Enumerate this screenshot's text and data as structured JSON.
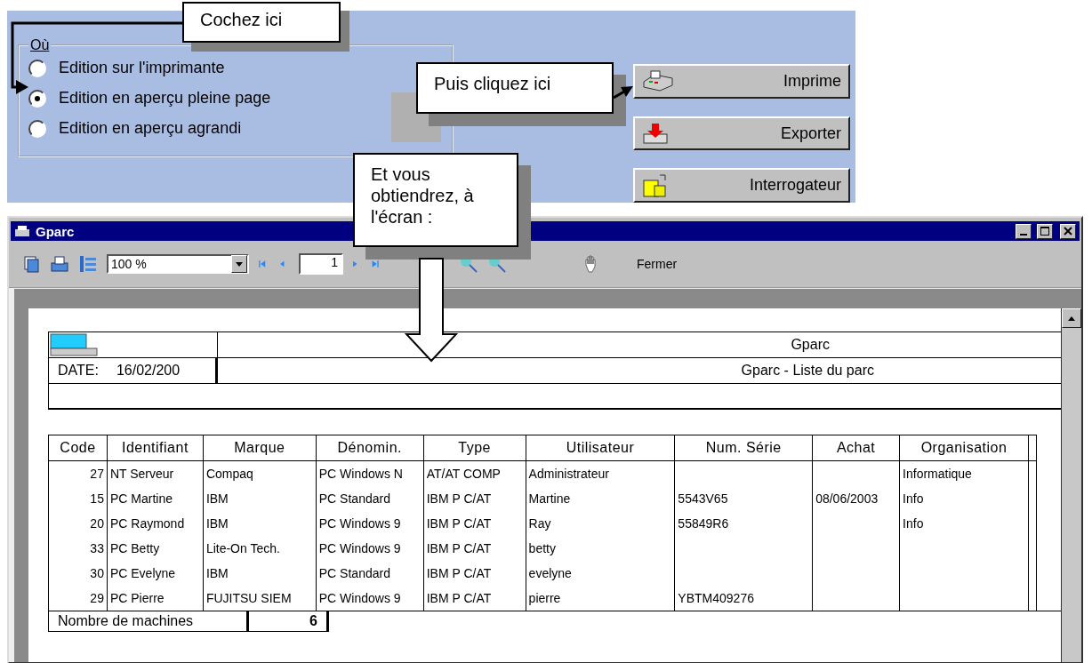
{
  "dialog": {
    "group_label": "Où",
    "options": [
      {
        "label": "Edition sur l'imprimante",
        "selected": false
      },
      {
        "label": "Edition en aperçu pleine page",
        "selected": true
      },
      {
        "label": "Edition en aperçu agrandi",
        "selected": false
      }
    ],
    "buttons": [
      {
        "label": "Imprime",
        "kind": "print"
      },
      {
        "label": "Exporter",
        "kind": "export"
      },
      {
        "label": "Interrogateur",
        "kind": "query"
      }
    ]
  },
  "callouts": [
    {
      "text": "Cochez ici",
      "kind": "check"
    },
    {
      "text": "Puis cliquez ici",
      "kind": "click"
    },
    {
      "text": "Et vous obtiendrez, à l'écran :",
      "kind": "result"
    }
  ],
  "window": {
    "title": "Gparc",
    "toolbar": {
      "zoom_value": "100 %",
      "page_value": "1",
      "close_label": "Fermer"
    },
    "report": {
      "title": "Gparc",
      "date_label": "DATE:",
      "date_value": "16/02/200",
      "subtitle": "Gparc - Liste du parc",
      "columns": [
        "Code",
        "Identifiant",
        "Marque",
        "Dénomin.",
        "Type",
        "Utilisateur",
        "Num. Série",
        "Achat",
        "Organisation"
      ],
      "rows": [
        [
          "27",
          "NT Serveur",
          "Compaq",
          "PC Windows N",
          "AT/AT COMP",
          "Administrateur",
          "",
          "",
          "Informatique"
        ],
        [
          "15",
          "PC Martine",
          "IBM",
          "PC Standard",
          "IBM P C/AT",
          "Martine",
          "5543V65",
          "08/06/2003",
          "Info"
        ],
        [
          "20",
          "PC Raymond",
          "IBM",
          "PC Windows 9",
          "IBM P C/AT",
          "Ray",
          "55849R6",
          "",
          "Info"
        ],
        [
          "33",
          "PC Betty",
          "Lite-On Tech.",
          "PC Windows 9",
          "IBM P C/AT",
          "betty",
          "",
          "",
          ""
        ],
        [
          "30",
          "PC Evelyne",
          "IBM",
          "PC Standard",
          "IBM P C/AT",
          "evelyne",
          "",
          "",
          ""
        ],
        [
          "29",
          "PC Pierre",
          "FUJITSU SIEM",
          "PC Windows 9",
          "IBM P C/AT",
          "pierre",
          "YBTM409276",
          "",
          ""
        ]
      ],
      "footer_label": "Nombre de machines",
      "footer_value": "6"
    }
  }
}
